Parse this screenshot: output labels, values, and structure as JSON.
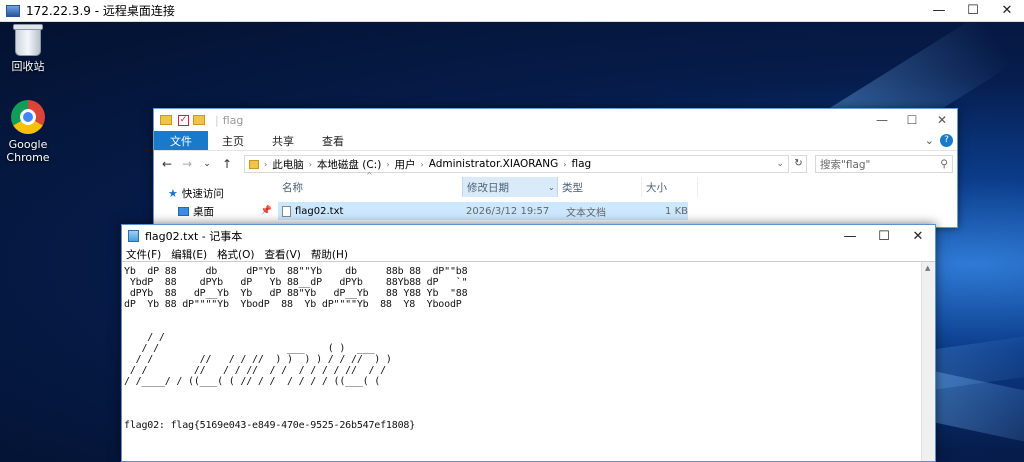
{
  "rdp": {
    "title": "172.22.3.9 - 远程桌面连接",
    "minimize": "—",
    "maximize": "☐",
    "close": "✕"
  },
  "desktop": {
    "recycle_bin": "回收站",
    "chrome_line1": "Google",
    "chrome_line2": "Chrome"
  },
  "explorer": {
    "title": "flag",
    "sep": "|",
    "check": "✓",
    "minimize": "—",
    "maximize": "☐",
    "close": "✕",
    "tabs": [
      "文件",
      "主页",
      "共享",
      "查看"
    ],
    "ribbon_expand": "⌄",
    "help": "?",
    "nav_back": "←",
    "nav_forward": "→",
    "nav_down": "⌄",
    "nav_up": "↑",
    "breadcrumb": [
      "此电脑",
      "本地磁盘 (C:)",
      "用户",
      "Administrator.XIAORANG",
      "flag"
    ],
    "crumb_sep": "›",
    "addr_dropdown": "⌄",
    "refresh": "↻",
    "search_placeholder": "搜索\"flag\"",
    "search_icon": "⚲",
    "quick_access": "快速访问",
    "star": "★",
    "desktop_label": "桌面",
    "pin": "📌",
    "sort_arrow": "^",
    "col_name": "名称",
    "col_date": "修改日期",
    "col_sort": "⌄",
    "col_type": "类型",
    "col_size": "大小",
    "file": {
      "name": "flag02.txt",
      "date": "2026/3/12 19:57",
      "type": "文本文档",
      "size": "1 KB"
    }
  },
  "notepad": {
    "title": "flag02.txt - 记事本",
    "minimize": "—",
    "maximize": "☐",
    "close": "✕",
    "menu": [
      "文件(F)",
      "编辑(E)",
      "格式(O)",
      "查看(V)",
      "帮助(H)"
    ],
    "scroll_up": "▲",
    "content": "Yb  dP 88     db     dP\"Yb  88\"\"Yb    db     88b 88  dP\"\"b8\n YbdP  88    dPYb   dP   Yb 88__dP   dPYb    88Yb88 dP   `\"\n dPYb  88   dP__Yb  Yb   dP 88\"Yb   dP__Yb   88 Y88 Yb  \"88\ndP  Yb 88 dP\"\"\"\"Yb  YbodP  88  Yb dP\"\"\"\"Yb  88  Y8  YboodP\n\n\n    / /\n   / /                      ___    ( )  ___\n  / /        //   / / //  ) )  ) ) / / //  ) )\n / /        //   / / //  / /  / / / / //  / /\n/ /____/ / ((___( ( // / /  / / / / ((___( (\n\n\n\nflag02: flag{5169e043-e849-470e-9525-26b547ef1808}"
  }
}
